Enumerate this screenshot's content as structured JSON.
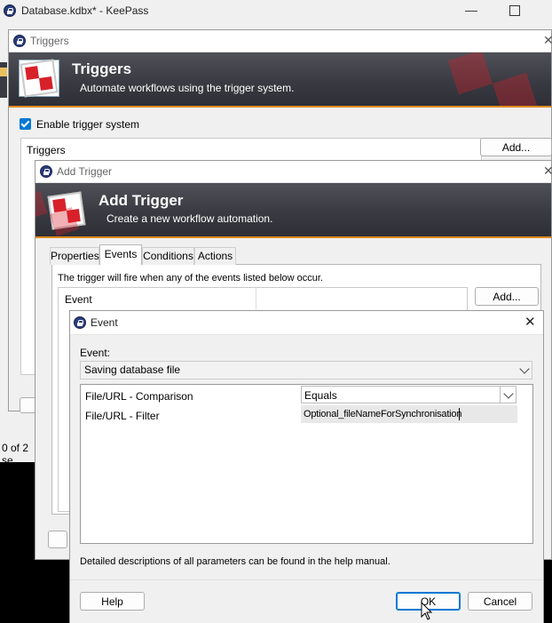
{
  "main_window": {
    "title": "Database.kdbx* - KeePass",
    "status_fragment": "0 of 2 se"
  },
  "triggers_dialog": {
    "title": "Triggers",
    "banner_title": "Triggers",
    "banner_subtitle": "Automate workflows using the trigger system.",
    "enable_label": "Enable trigger system",
    "enable_checked": true,
    "list_header": "Triggers",
    "add_label": "Add..."
  },
  "add_trigger_dialog": {
    "title": "Add Trigger",
    "banner_title": "Add Trigger",
    "banner_subtitle": "Create a new workflow automation.",
    "tabs": [
      "Properties",
      "Events",
      "Conditions",
      "Actions"
    ],
    "active_tab": "Events",
    "info_text": "The trigger will fire when any of the events listed below occur.",
    "list_header": "Event",
    "add_label": "Add..."
  },
  "event_dialog": {
    "title": "Event",
    "close_glyph": "✕",
    "event_label": "Event:",
    "event_value": "Saving database file",
    "params": [
      {
        "name": "File/URL - Comparison",
        "value": "Equals"
      },
      {
        "name": "File/URL - Filter",
        "value": "Optional_fileNameForSynchronisation"
      }
    ],
    "help_note": "Detailed descriptions of all parameters can be found in the help manual.",
    "help_label": "Help",
    "ok_label": "OK",
    "cancel_label": "Cancel"
  },
  "colors": {
    "banner_dark": "#3a3a42",
    "banner_accent": "#e08a1e",
    "accent_blue": "#0078d4",
    "checker_red": "#d8202a"
  }
}
